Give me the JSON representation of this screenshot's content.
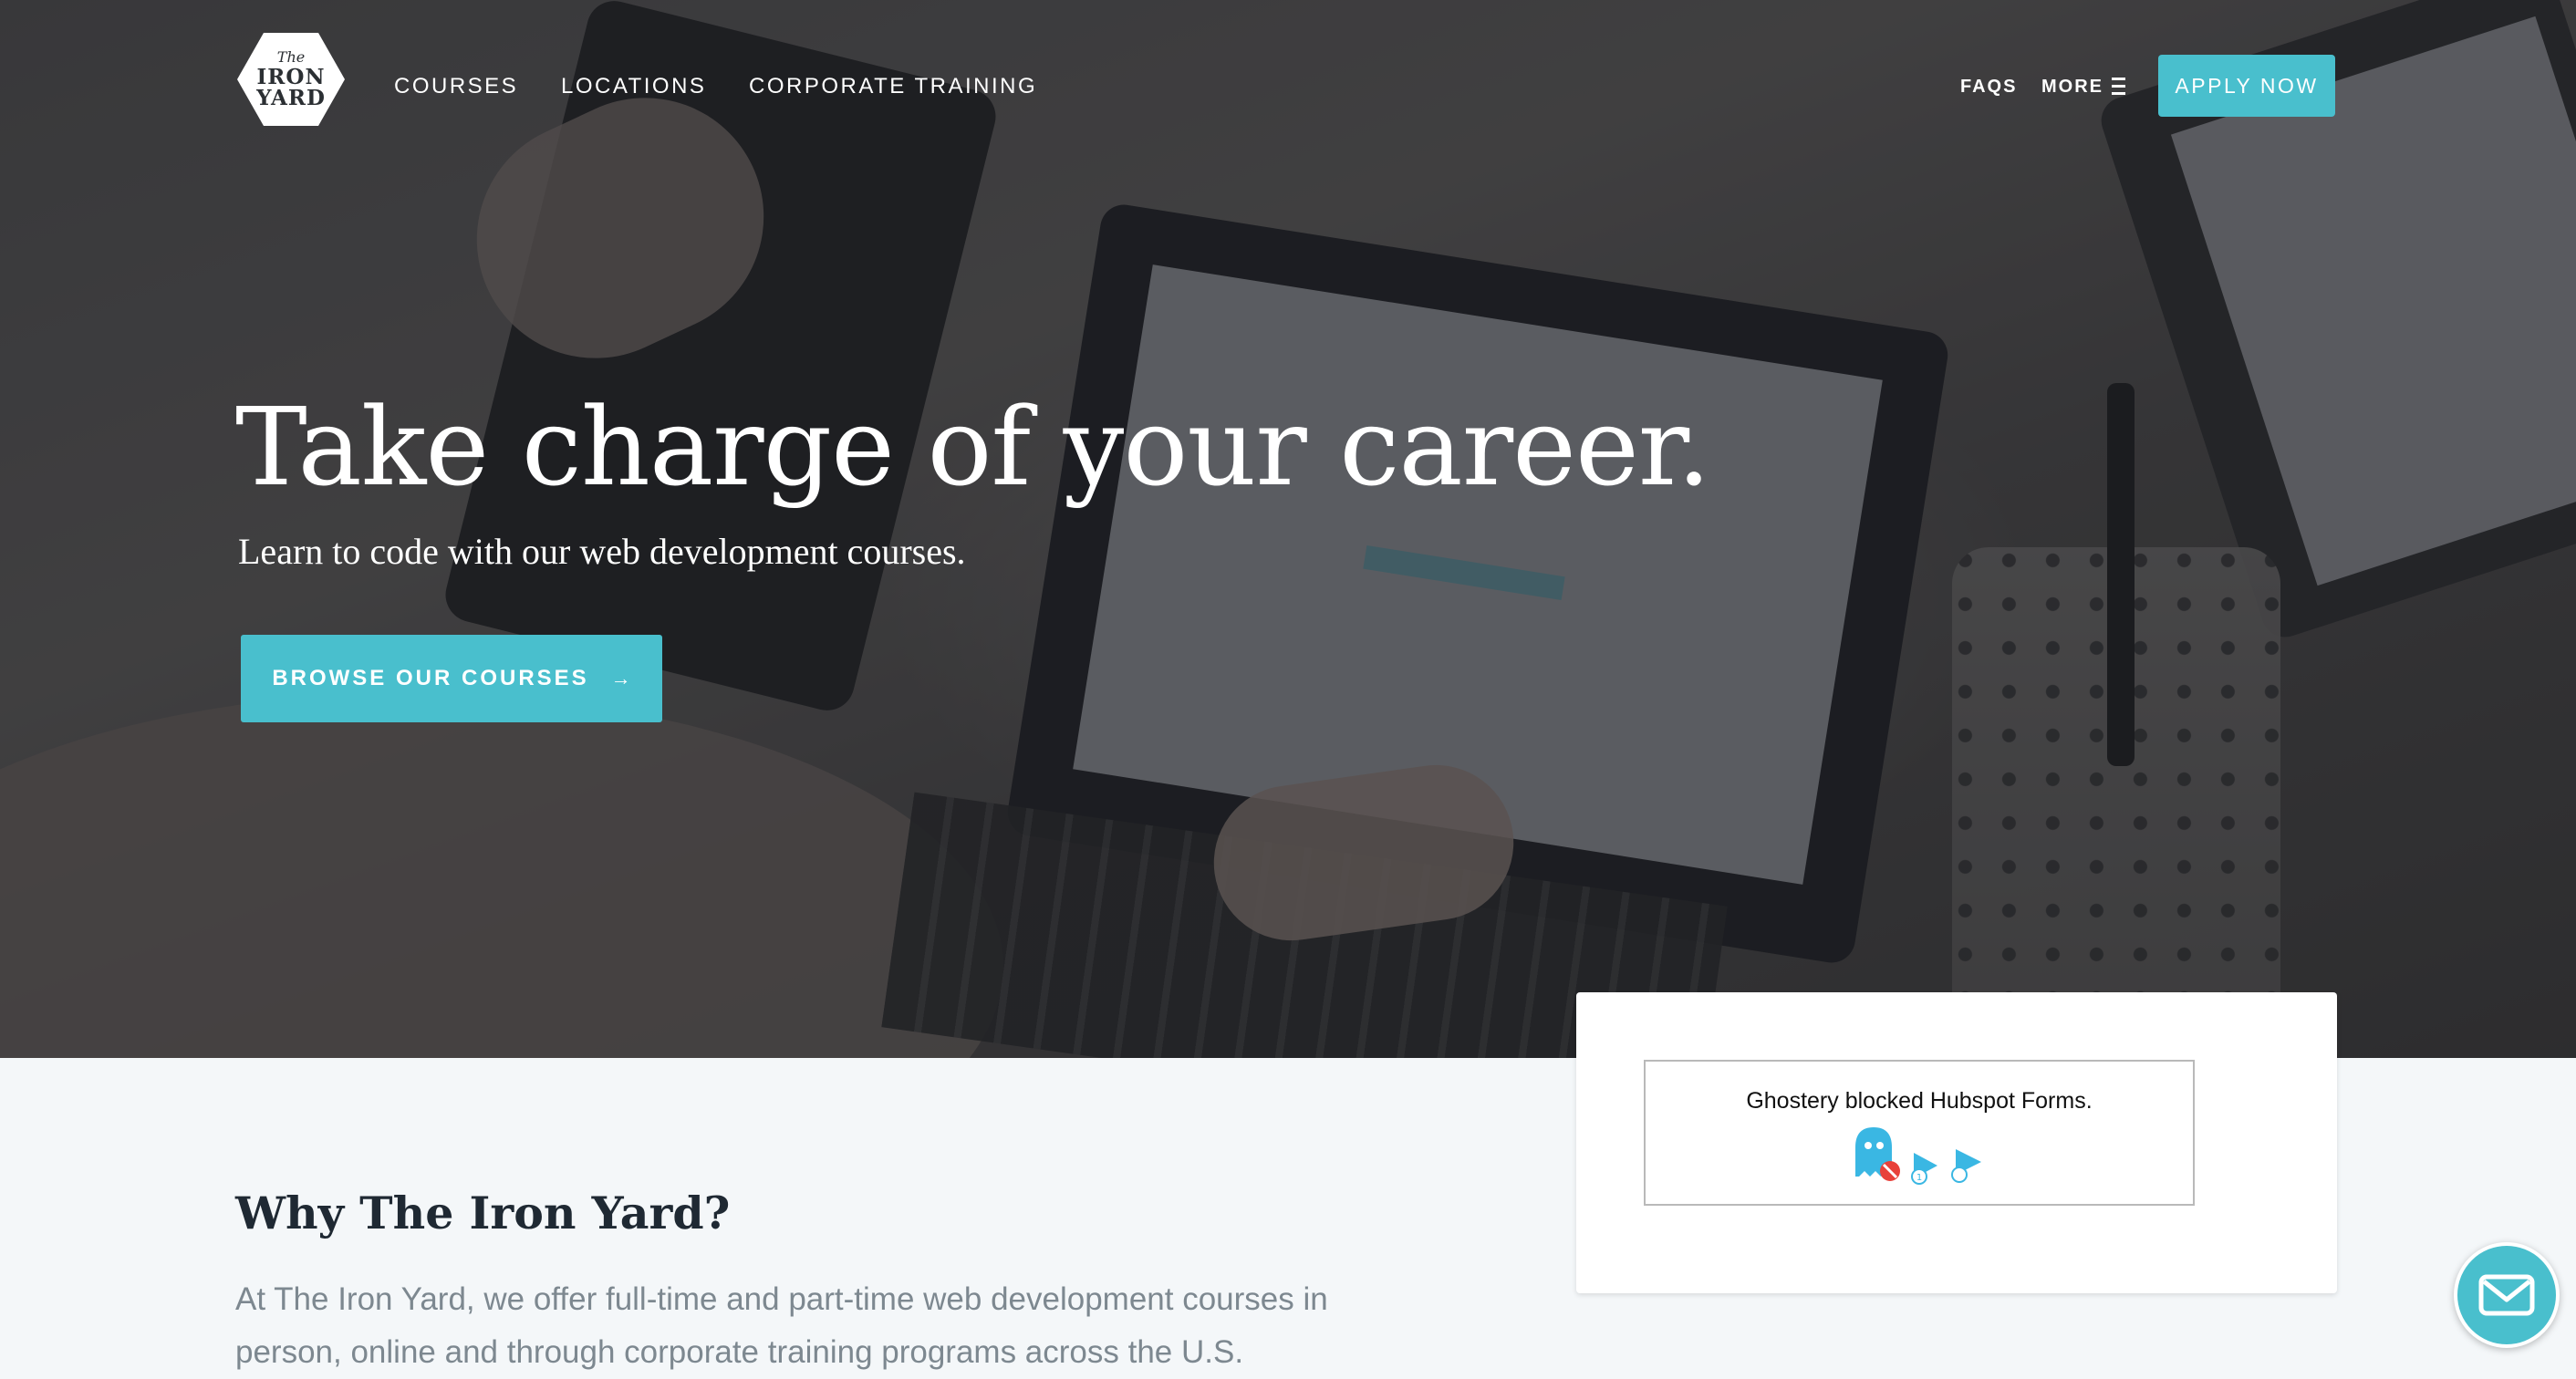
{
  "brand": {
    "logo_line1": "The",
    "logo_line2": "IRON",
    "logo_line3": "YARD"
  },
  "nav": {
    "courses": "COURSES",
    "locations": "LOCATIONS",
    "corporate_training": "CORPORATE TRAINING",
    "faqs": "FAQS",
    "more": "MORE",
    "apply_now": "APPLY NOW"
  },
  "hero": {
    "headline": "Take charge of your career.",
    "subhead": "Learn to code with our web development courses.",
    "cta_label": "BROWSE OUR COURSES",
    "cta_icon": "→"
  },
  "why": {
    "title": "Why The Iron Yard?",
    "body": "At The Iron Yard, we offer full-time and part-time web development courses in person, online and through corporate training programs across the U.S."
  },
  "form_card": {
    "blocked_message": "Ghostery blocked Hubspot Forms."
  },
  "colors": {
    "accent": "#49bfcd",
    "heading_dark": "#1f2933",
    "body_gray": "#7d8890",
    "section_bg": "#f4f7f9"
  },
  "icons": {
    "menu": "hamburger-icon",
    "cta_arrow": "arrow-right-icon",
    "ghostery": "ghostery-ghost-icon",
    "chat": "envelope-icon"
  }
}
